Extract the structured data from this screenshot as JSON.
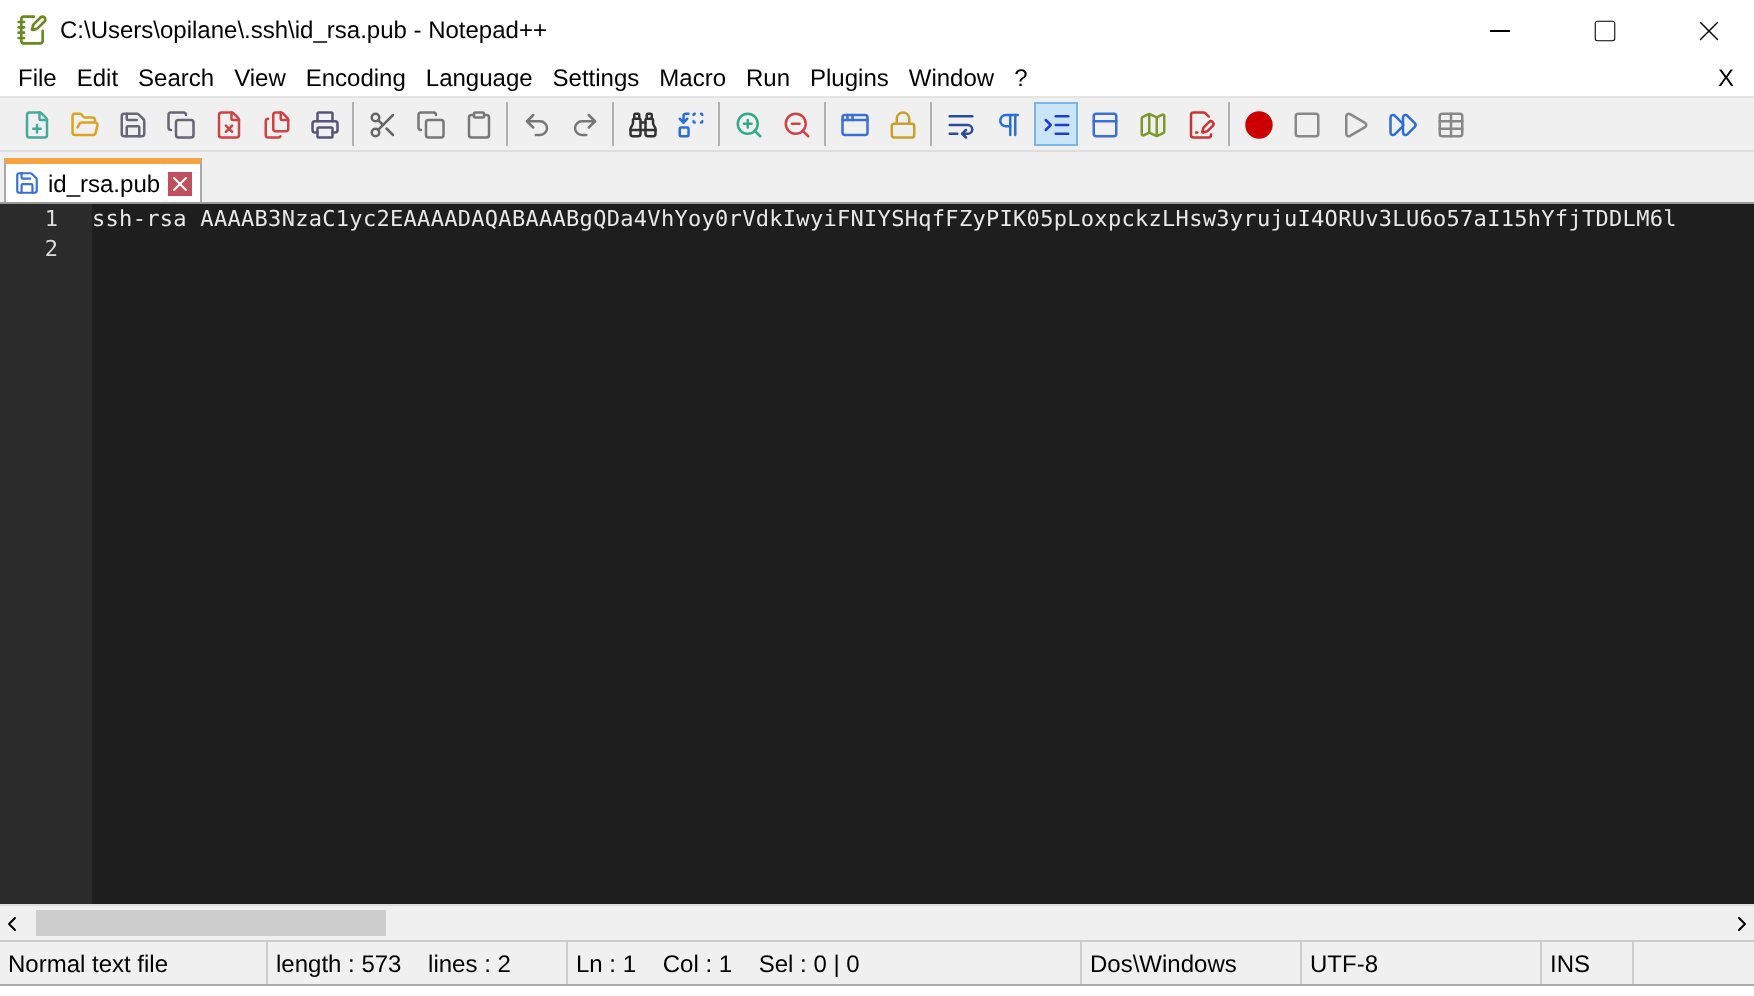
{
  "window": {
    "title": "C:\\Users\\opilane\\.ssh\\id_rsa.pub - Notepad++"
  },
  "menu": {
    "items": [
      "File",
      "Edit",
      "Search",
      "View",
      "Encoding",
      "Language",
      "Settings",
      "Macro",
      "Run",
      "Plugins",
      "Window",
      "?"
    ],
    "close_label": "X"
  },
  "toolbar": {
    "groups": [
      [
        {
          "selected": false
        },
        {
          "selected": false
        },
        {
          "selected": false
        },
        {
          "selected": false
        },
        {
          "selected": false
        },
        {
          "selected": false
        },
        {
          "selected": false
        }
      ],
      [
        {
          "selected": false
        },
        {
          "selected": false
        },
        {
          "selected": false
        }
      ],
      [
        {
          "selected": false
        },
        {
          "selected": false
        }
      ],
      [
        {
          "selected": false
        },
        {
          "selected": false
        }
      ],
      [
        {
          "selected": false
        },
        {
          "selected": false
        }
      ],
      [
        {
          "selected": false
        },
        {
          "selected": false
        }
      ],
      [
        {
          "selected": false
        },
        {
          "selected": false
        },
        {
          "selected": true
        },
        {
          "selected": false
        },
        {
          "selected": false
        },
        {
          "selected": false
        }
      ],
      [
        {
          "selected": false
        },
        {
          "selected": false
        },
        {
          "selected": false
        },
        {
          "selected": false
        },
        {
          "selected": false
        }
      ]
    ]
  },
  "tabs": [
    {
      "label": "id_rsa.pub",
      "selected": true
    }
  ],
  "editor": {
    "lines": [
      {
        "number": "1",
        "text": "ssh-rsa AAAAB3NzaC1yc2EAAAADAQABAAABgQDa4VhYoy0rVdkIwyiFNIYSHqfFZyPIK05pLoxpckzLHsw3yrujuI4ORUv3LU6o57aI15hYfjTDDLM6l"
      },
      {
        "number": "2"
      }
    ]
  },
  "status_bar": [
    "Normal text file",
    "length : 573    lines : 2",
    "Ln : 1    Col : 1    Sel : 0 | 0",
    "Dos\\Windows",
    "UTF-8",
    "INS"
  ]
}
